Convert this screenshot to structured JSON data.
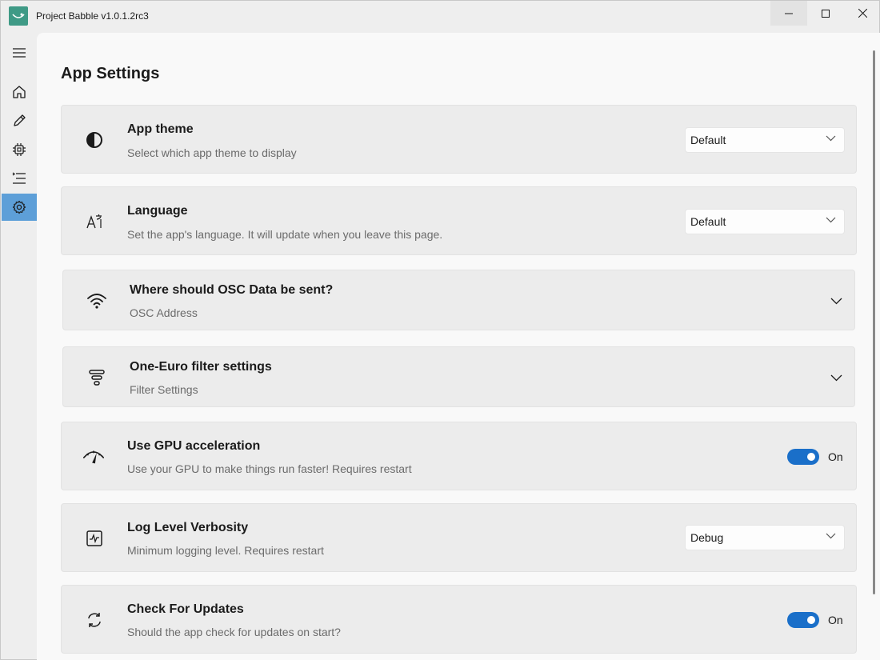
{
  "window": {
    "title": "Project Babble v1.0.1.2rc3",
    "controls": {
      "minimize": "—",
      "maximize": "☐",
      "close": "✕"
    }
  },
  "sidebar": {
    "items": [
      {
        "name": "menu",
        "icon": "hamburger-icon"
      },
      {
        "name": "home",
        "icon": "home-icon"
      },
      {
        "name": "edit",
        "icon": "pencil-icon"
      },
      {
        "name": "hardware",
        "icon": "chip-icon"
      },
      {
        "name": "list",
        "icon": "list-icon"
      },
      {
        "name": "settings",
        "icon": "gear-icon",
        "active": true
      }
    ]
  },
  "page": {
    "title": "App Settings"
  },
  "settings": {
    "theme": {
      "title": "App theme",
      "desc": "Select which app theme to display",
      "value": "Default",
      "icon": "contrast-icon"
    },
    "language": {
      "title": "Language",
      "desc": "Set the app's language. It will update when you leave this page.",
      "value": "Default",
      "icon": "language-icon"
    },
    "osc": {
      "title": "Where should OSC Data be sent?",
      "desc": "OSC Address",
      "icon": "wifi-icon"
    },
    "filter": {
      "title": "One-Euro filter settings",
      "desc": "Filter Settings",
      "icon": "filter-icon"
    },
    "gpu": {
      "title": "Use GPU acceleration",
      "desc": "Use your GPU to make things run faster! Requires restart",
      "state": "On",
      "icon": "gauge-icon"
    },
    "log": {
      "title": "Log Level Verbosity",
      "desc": "Minimum logging level. Requires restart",
      "value": "Debug",
      "icon": "activity-icon"
    },
    "updates": {
      "title": "Check For Updates",
      "desc": "Should the app check for updates on start?",
      "state": "On",
      "icon": "refresh-icon"
    }
  },
  "colors": {
    "accent": "#1a6fc9",
    "sidebar_active": "#5d9fd8",
    "app_icon": "#3f9a86"
  }
}
